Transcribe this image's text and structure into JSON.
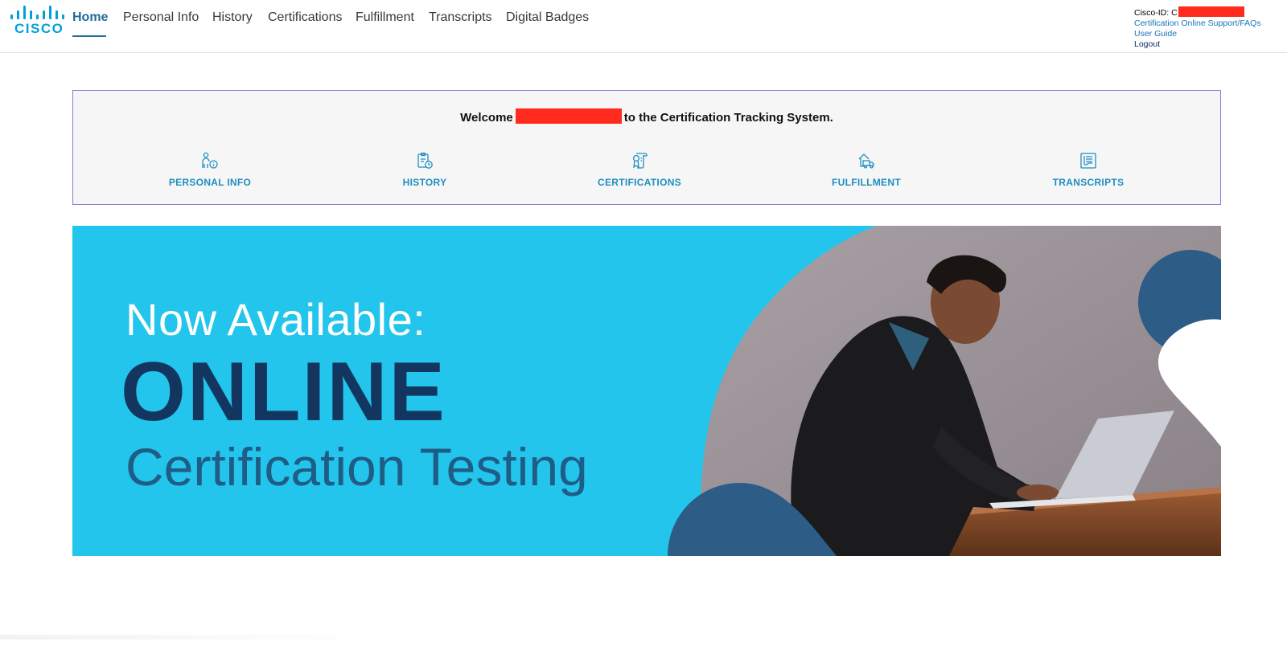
{
  "brand": {
    "logo_text": "CISCO",
    "color": "#049fd9"
  },
  "nav": {
    "items": [
      {
        "label": "Home",
        "active": true
      },
      {
        "label": "Personal Info",
        "active": false
      },
      {
        "label": "History",
        "active": false
      },
      {
        "label": "Certifications",
        "active": false
      },
      {
        "label": "Fulfillment",
        "active": false
      },
      {
        "label": "Transcripts",
        "active": false
      },
      {
        "label": "Digital Badges",
        "active": false
      }
    ]
  },
  "account": {
    "cisco_id_label": "Cisco-ID: C",
    "support_link": "Certification Online Support/FAQs",
    "guide_link": "User Guide",
    "logout": "Logout"
  },
  "welcome": {
    "before": "Welcome",
    "after": "to the Certification Tracking System."
  },
  "quick_links": [
    {
      "label": "PERSONAL INFO",
      "icon": "person-info-icon"
    },
    {
      "label": "HISTORY",
      "icon": "clipboard-clock-icon"
    },
    {
      "label": "CERTIFICATIONS",
      "icon": "certificate-icon"
    },
    {
      "label": "FULFILLMENT",
      "icon": "delivery-truck-icon"
    },
    {
      "label": "TRANSCRIPTS",
      "icon": "document-list-icon"
    }
  ],
  "banner": {
    "line1": "Now Available:",
    "line2": "ONLINE",
    "line3": "Certification Testing"
  },
  "colors": {
    "banner_bg": "#23c5ec",
    "banner_dark": "#12365f",
    "link": "#1e8fbf",
    "redaction": "#ff2b1c"
  }
}
